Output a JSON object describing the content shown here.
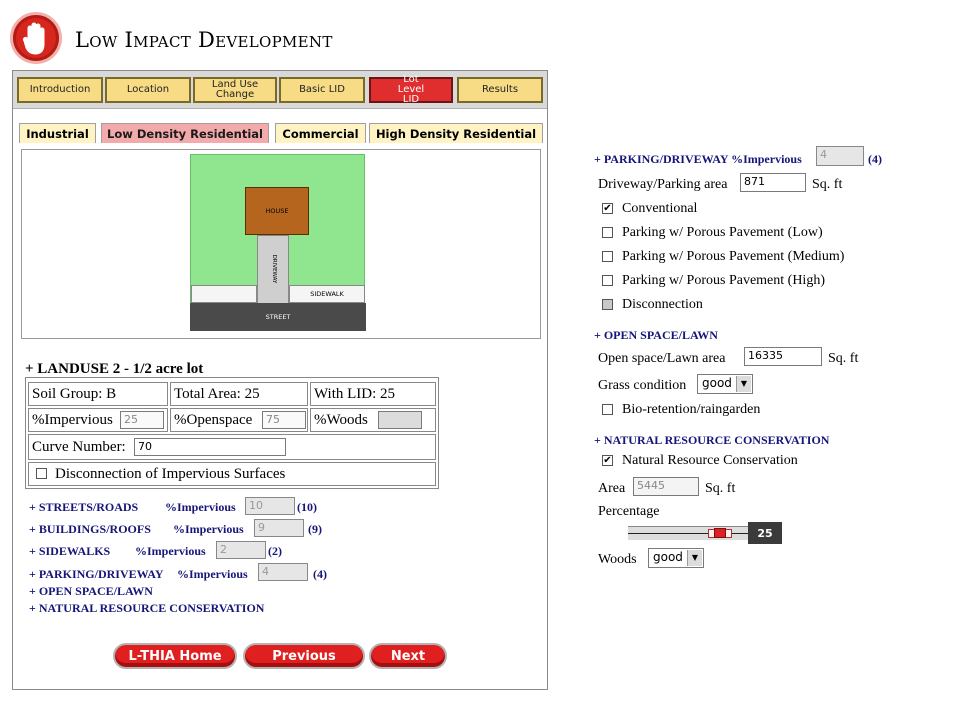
{
  "header": {
    "title": "Low Impact Development"
  },
  "nav_tabs": [
    "Introduction",
    "Location",
    "Land Use Change",
    "Basic LID",
    "Lot Level LID",
    "Results"
  ],
  "nav_active_index": 4,
  "landuse_tabs": [
    "Industrial",
    "Low Density Residential",
    "Commercial",
    "High Density Residential"
  ],
  "landuse_active_index": 1,
  "map": {
    "house": "HOUSE",
    "driveway": "DRIVEWAY",
    "sidewalk": "SIDEWALK",
    "street": "STREET"
  },
  "landuse": {
    "title": "+ LANDUSE 2 - 1/2 acre lot",
    "soil_group": "Soil Group: B",
    "total_area": "Total Area: 25",
    "with_lid": "With LID: 25",
    "impervious_label": "%Impervious",
    "impervious_value": "25",
    "openspace_label": "%Openspace",
    "openspace_value": "75",
    "woods_label": "%Woods",
    "woods_value": "",
    "curve_label": "Curve Number:",
    "curve_value": "70",
    "disconnection_label": "Disconnection of Impervious Surfaces"
  },
  "surfaces": [
    {
      "label": "+ STREETS/ROADS",
      "imp_label": "%Impervious",
      "value": "10",
      "paren": "(10)"
    },
    {
      "label": "+ BUILDINGS/ROOFS",
      "imp_label": "%Impervious",
      "value": "9",
      "paren": "(9)"
    },
    {
      "label": "+ SIDEWALKS",
      "imp_label": "%Impervious",
      "value": "2",
      "paren": "(2)"
    },
    {
      "label": "+ PARKING/DRIVEWAY",
      "imp_label": "%Impervious",
      "value": "4",
      "paren": "(4)"
    },
    {
      "label": "+ OPEN SPACE/LAWN"
    },
    {
      "label": "+ NATURAL RESOURCE CONSERVATION"
    }
  ],
  "buttons": {
    "home": "L-THIA Home",
    "previous": "Previous",
    "next": "Next"
  },
  "right": {
    "parking_head": "+ PARKING/DRIVEWAY %Impervious",
    "parking_value": "4",
    "parking_paren": "(4)",
    "driveway_area_label": "Driveway/Parking area",
    "driveway_area_value": "871",
    "sqft": "Sq. ft",
    "parking_options": [
      {
        "label": "Conventional",
        "checked": true
      },
      {
        "label": "Parking w/ Porous Pavement (Low)",
        "checked": false
      },
      {
        "label": "Parking w/ Porous Pavement (Medium)",
        "checked": false
      },
      {
        "label": "Parking w/ Porous Pavement (High)",
        "checked": false
      },
      {
        "label": "Disconnection",
        "checked": false
      }
    ],
    "open_head": "+ OPEN SPACE/LAWN",
    "open_area_label": "Open space/Lawn area",
    "open_area_value": "16335",
    "grass_label": "Grass condition",
    "grass_value": "good",
    "bioretention_label": "Bio-retention/raingarden",
    "natural_head": "+ NATURAL RESOURCE CONSERVATION",
    "natural_label": "Natural Resource Conservation",
    "area_label": "Area",
    "area_value": "5445",
    "percentage_label": "Percentage",
    "percentage_value": "25",
    "woods_label": "Woods",
    "woods_value": "good"
  },
  "colors": {
    "accent_red": "#e02020",
    "tab_yellow": "#f7dc85",
    "link_blue": "#15157a"
  }
}
